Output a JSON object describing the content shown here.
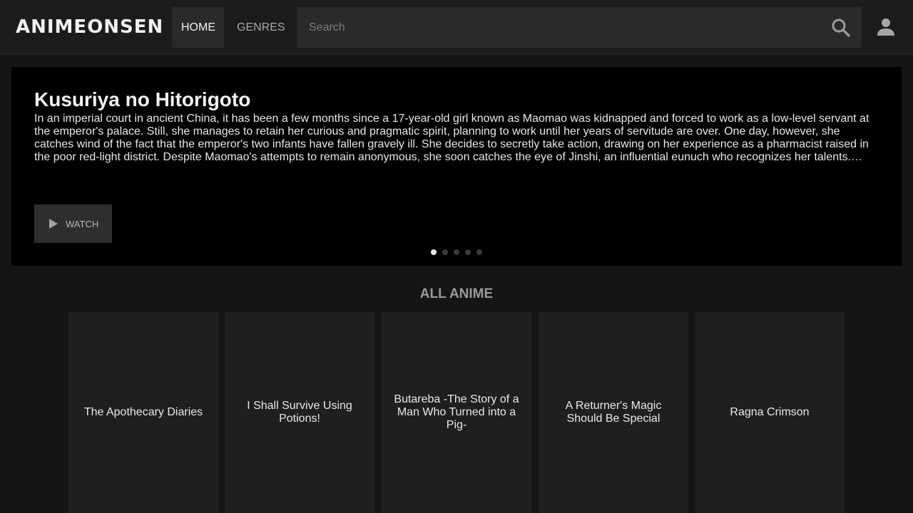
{
  "header": {
    "logo": "ANIMEONSEN",
    "nav": [
      {
        "label": "HOME",
        "active": true
      },
      {
        "label": "GENRES",
        "active": false
      }
    ],
    "search": {
      "placeholder": "Search",
      "value": ""
    },
    "icons": {
      "search": "search-icon",
      "user": "user-icon"
    }
  },
  "hero": {
    "title": "Kusuriya no Hitorigoto",
    "description": "In an imperial court in ancient China, it has been a few months since a 17-year-old girl known as Maomao was kidnapped and forced to work as a low-level servant at the emperor's palace. Still, she manages to retain her curious and pragmatic spirit, planning to work until her years of servitude are over. One day, however, she catches wind of the fact that the emperor's two infants have fallen gravely ill. She decides to secretly take action, drawing on her experience as a pharmacist raised in the poor red-light district. Despite Maomao's attempts to remain anonymous, she soon catches the eye of Jinshi, an influential eunuch who recognizes her talents.…",
    "watch_label": "WATCH",
    "slide_count": 5,
    "active_slide": 1
  },
  "section": {
    "title": "ALL ANIME"
  },
  "cards": [
    {
      "title": "The Apothecary Diaries"
    },
    {
      "title": "I Shall Survive Using Potions!"
    },
    {
      "title": "Butareba -The Story of a Man Who Turned into a Pig-"
    },
    {
      "title": "A Returner's Magic Should Be Special"
    },
    {
      "title": "Ragna Crimson"
    }
  ],
  "colors": {
    "background": "#151515",
    "header": "#1c1c1c",
    "hero": "#000000",
    "card": "#1f1f1f",
    "accent_text": "#e6e6e6"
  }
}
